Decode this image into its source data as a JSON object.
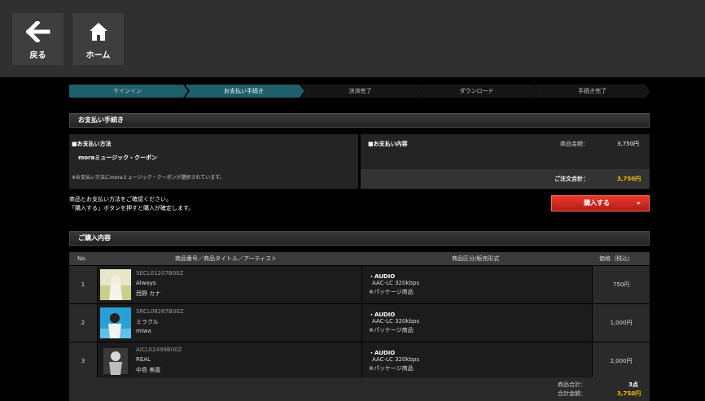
{
  "nav": {
    "back_label": "戻る",
    "home_label": "ホーム"
  },
  "steps": [
    "サインイン",
    "お支払い手続き",
    "決済完了",
    "ダウンロード",
    "手続き完了"
  ],
  "active_step_color": "#1e5f6a",
  "payment": {
    "section_title": "お支払い手続き",
    "method_heading": "■お支払い方法",
    "method_value": "moraミュージック・クーポン",
    "method_note": "※お支払い方法にmoraミュージック・クーポンが選択されています。",
    "content_heading": "■お支払い内容",
    "subtotal_label": "商品金額：",
    "subtotal_value": "3,750円",
    "total_label": "ご注文合計：",
    "total_value": "3,750円"
  },
  "confirm": {
    "line1": "商品とお支払い方法をご確認ください。",
    "line2": "「購入する」ボタンを押すと購入が確定します。",
    "buy_label": "購入する",
    "buy_arrow": "»"
  },
  "cart": {
    "section_title": "ご購入内容",
    "headers": {
      "no": "No.",
      "item": "商品番号／商品タイトル／アーティスト",
      "type": "商品区分/販売形式",
      "price": "価格（税込）"
    },
    "rows": [
      {
        "no": "1",
        "code": "SECL01207B00Z",
        "title": "Always",
        "artist": "西野 カナ",
        "type_a": "・AUDIO",
        "type_b": "AAC-LC 320kbps",
        "type_c": "※パッケージ商品",
        "price": "750円"
      },
      {
        "no": "2",
        "code": "SRCL08267B00Z",
        "title": "ミラクル",
        "artist": "miwa",
        "type_a": "・AUDIO",
        "type_b": "AAC-LC 320kbps",
        "type_c": "※パッケージ商品",
        "price": "1,000円"
      },
      {
        "no": "3",
        "code": "AICL02499B00Z",
        "title": "REAL",
        "artist": "中島 美嘉",
        "type_a": "・AUDIO",
        "type_b": "AAC-LC 320kbps",
        "type_c": "※パッケージ商品",
        "price": "2,000円"
      }
    ],
    "count_label": "商品合計：",
    "count_value": "3点",
    "sum_label": "合計金額：",
    "sum_value": "3,750円"
  }
}
